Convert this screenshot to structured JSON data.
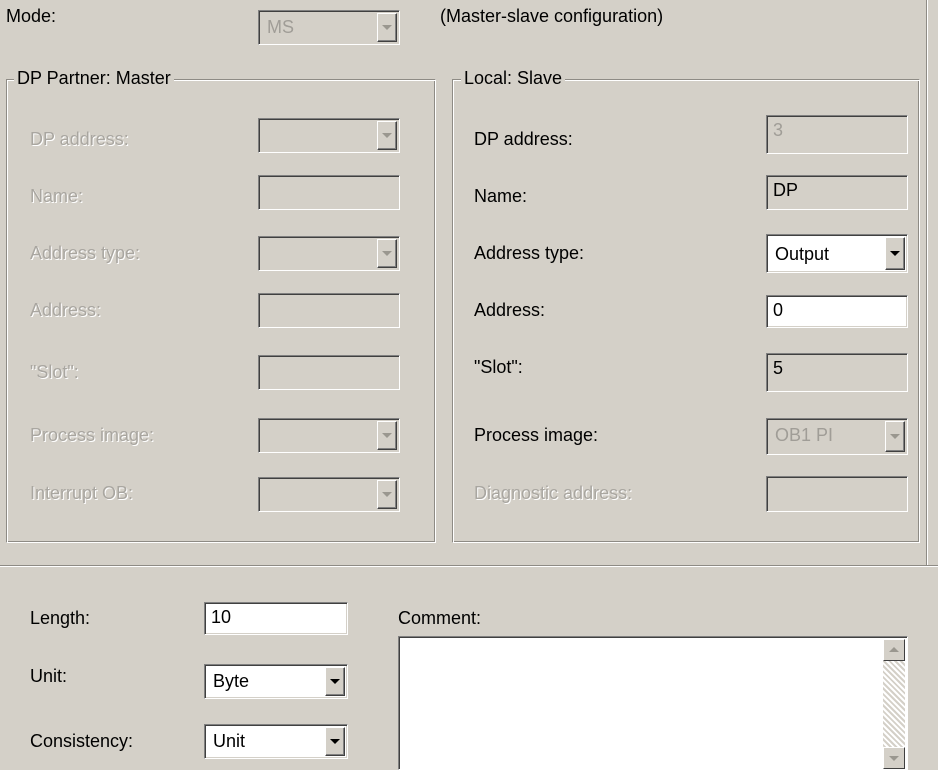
{
  "mode": {
    "label": "Mode:",
    "value": "MS",
    "description": "(Master-slave configuration)"
  },
  "dp_partner": {
    "title": "DP Partner: Master",
    "dp_address_label": "DP address:",
    "name_label": "Name:",
    "address_type_label": "Address type:",
    "address_label": "Address:",
    "slot_label": "\"Slot\":",
    "process_image_label": "Process image:",
    "interrupt_ob_label": "Interrupt OB:"
  },
  "local": {
    "title": "Local: Slave",
    "dp_address_label": "DP address:",
    "dp_address_value": "3",
    "name_label": "Name:",
    "name_value": "DP",
    "address_type_label": "Address type:",
    "address_type_value": "Output",
    "address_label": "Address:",
    "address_value": "0",
    "slot_label": "\"Slot\":",
    "slot_value": "5",
    "process_image_label": "Process image:",
    "process_image_value": "OB1 PI",
    "diagnostic_label": "Diagnostic address:"
  },
  "bottom": {
    "length_label": "Length:",
    "length_value": "10",
    "unit_label": "Unit:",
    "unit_value": "Byte",
    "consistency_label": "Consistency:",
    "consistency_value": "Unit",
    "comment_label": "Comment:"
  },
  "icons": {
    "dropdown": "chevron-down-icon",
    "scroll_up": "scroll-up-icon",
    "scroll_down": "scroll-down-icon"
  },
  "colors": {
    "background": "#d4d0c8",
    "disabled_text": "#a9a6a0",
    "field_white": "#ffffff"
  }
}
